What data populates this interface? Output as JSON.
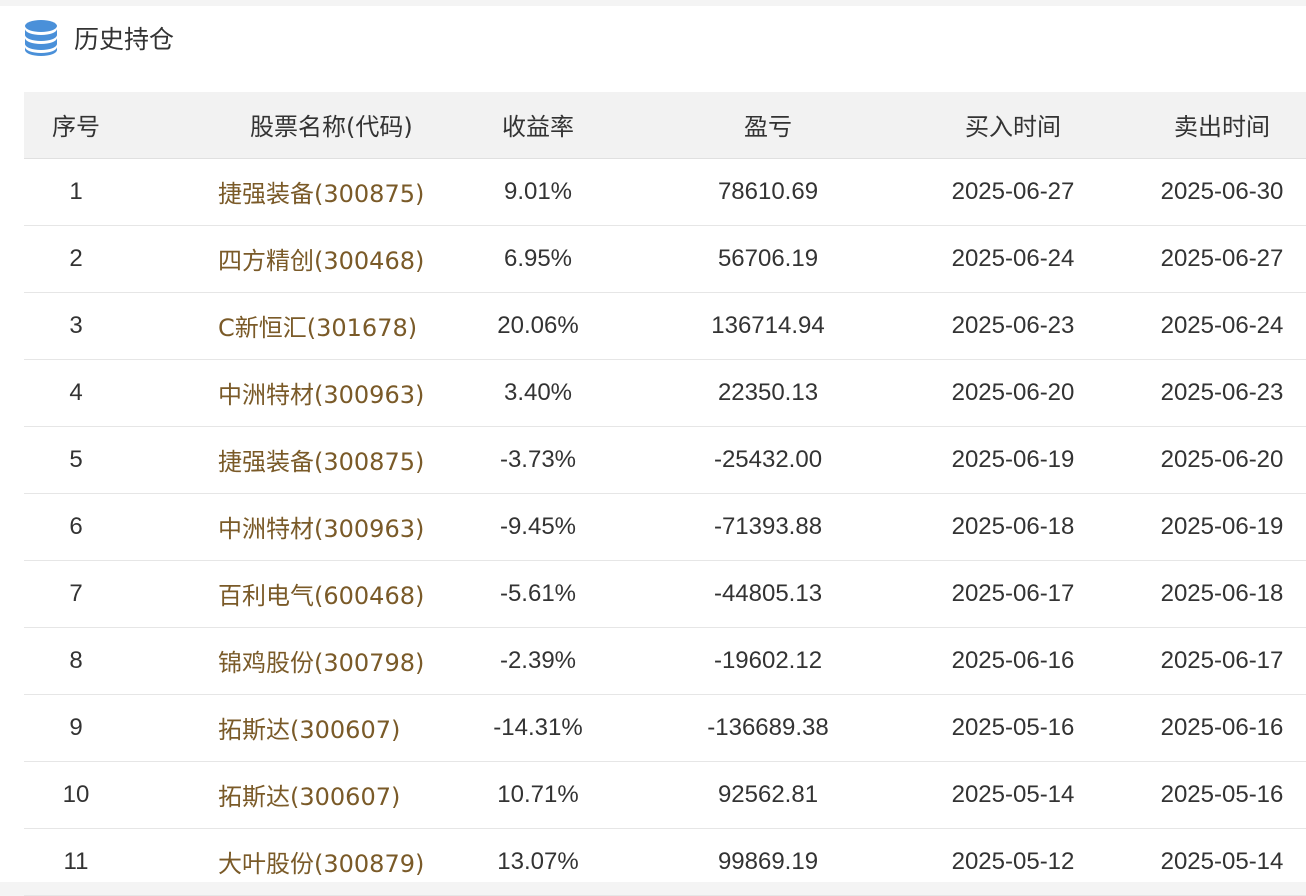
{
  "panel": {
    "title": "历史持仓",
    "icon": "database-icon",
    "accent_color": "#4a90d9"
  },
  "table": {
    "headers": [
      "序号",
      "股票名称(代码)",
      "收益率",
      "盈亏",
      "买入时间",
      "卖出时间"
    ],
    "rows": [
      {
        "index": "1",
        "name": "捷强装备(300875)",
        "return_rate": "9.01%",
        "pnl": "78610.69",
        "buy_date": "2025-06-27",
        "sell_date": "2025-06-30",
        "sign": "pos"
      },
      {
        "index": "2",
        "name": "四方精创(300468)",
        "return_rate": "6.95%",
        "pnl": "56706.19",
        "buy_date": "2025-06-24",
        "sell_date": "2025-06-27",
        "sign": "pos"
      },
      {
        "index": "3",
        "name": "C新恒汇(301678)",
        "return_rate": "20.06%",
        "pnl": "136714.94",
        "buy_date": "2025-06-23",
        "sell_date": "2025-06-24",
        "sign": "pos"
      },
      {
        "index": "4",
        "name": "中洲特材(300963)",
        "return_rate": "3.40%",
        "pnl": "22350.13",
        "buy_date": "2025-06-20",
        "sell_date": "2025-06-23",
        "sign": "pos"
      },
      {
        "index": "5",
        "name": "捷强装备(300875)",
        "return_rate": "-3.73%",
        "pnl": "-25432.00",
        "buy_date": "2025-06-19",
        "sell_date": "2025-06-20",
        "sign": "neg"
      },
      {
        "index": "6",
        "name": "中洲特材(300963)",
        "return_rate": "-9.45%",
        "pnl": "-71393.88",
        "buy_date": "2025-06-18",
        "sell_date": "2025-06-19",
        "sign": "neg"
      },
      {
        "index": "7",
        "name": "百利电气(600468)",
        "return_rate": "-5.61%",
        "pnl": "-44805.13",
        "buy_date": "2025-06-17",
        "sell_date": "2025-06-18",
        "sign": "neg"
      },
      {
        "index": "8",
        "name": "锦鸡股份(300798)",
        "return_rate": "-2.39%",
        "pnl": "-19602.12",
        "buy_date": "2025-06-16",
        "sell_date": "2025-06-17",
        "sign": "neg"
      },
      {
        "index": "9",
        "name": "拓斯达(300607)",
        "return_rate": "-14.31%",
        "pnl": "-136689.38",
        "buy_date": "2025-05-16",
        "sell_date": "2025-06-16",
        "sign": "neg"
      },
      {
        "index": "10",
        "name": "拓斯达(300607)",
        "return_rate": "10.71%",
        "pnl": "92562.81",
        "buy_date": "2025-05-14",
        "sell_date": "2025-05-16",
        "sign": "pos"
      },
      {
        "index": "11",
        "name": "大叶股份(300879)",
        "return_rate": "13.07%",
        "pnl": "99869.19",
        "buy_date": "2025-05-12",
        "sell_date": "2025-05-14",
        "sign": "pos"
      }
    ]
  },
  "colors": {
    "positive": "#e23a2e",
    "negative": "#3f8a2c",
    "stock_name": "#7a5a28",
    "header_bg": "#f2f2f2"
  }
}
